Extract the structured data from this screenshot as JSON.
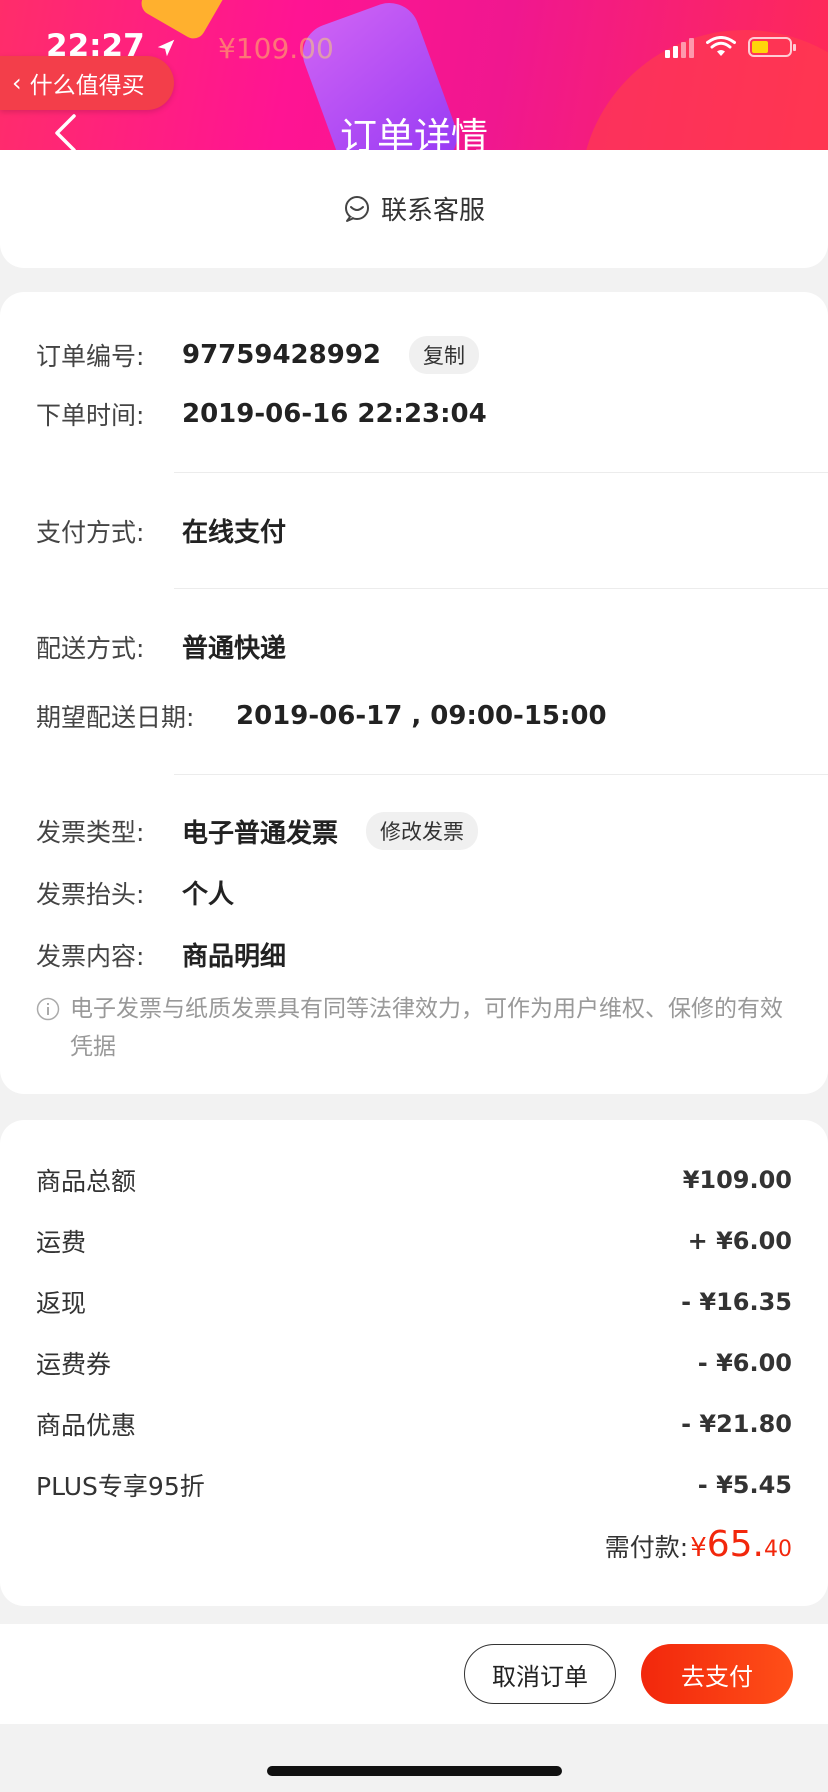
{
  "status_bar": {
    "time": "22:27"
  },
  "back_app": {
    "label": "什么值得买"
  },
  "header": {
    "title": "订单详情",
    "ghost_price": "¥109.00"
  },
  "service": {
    "label": "联系客服"
  },
  "order": {
    "number_label": "订单编号:",
    "number": "97759428992",
    "copy_label": "复制",
    "time_label": "下单时间:",
    "time": "2019-06-16 22:23:04",
    "payment_label": "支付方式:",
    "payment": "在线支付",
    "delivery_label": "配送方式:",
    "delivery": "普通快递",
    "expected_label": "期望配送日期:",
    "expected": "2019-06-17 , 09:00-15:00",
    "invoice_type_label": "发票类型:",
    "invoice_type": "电子普通发票",
    "modify_invoice_label": "修改发票",
    "invoice_title_label": "发票抬头:",
    "invoice_title": "个人",
    "invoice_content_label": "发票内容:",
    "invoice_content": "商品明细",
    "invoice_note": "电子发票与纸质发票具有同等法律效力，可作为用户维权、保修的有效凭据"
  },
  "price": {
    "rows": [
      {
        "label": "商品总额",
        "value": "¥109.00"
      },
      {
        "label": "运费",
        "value": "+ ¥6.00"
      },
      {
        "label": "返现",
        "value": "- ¥16.35"
      },
      {
        "label": "运费券",
        "value": "- ¥6.00"
      },
      {
        "label": "商品优惠",
        "value": "- ¥21.80"
      },
      {
        "label": "PLUS专享95折",
        "value": "- ¥5.45"
      }
    ],
    "due_label": "需付款:",
    "due_symbol": "¥",
    "due_integer": "65.",
    "due_decimal": "40"
  },
  "actions": {
    "cancel_label": "取消订单",
    "pay_label": "去支付"
  },
  "colors": {
    "accent": "#f2270c",
    "header": "#ff1493"
  }
}
